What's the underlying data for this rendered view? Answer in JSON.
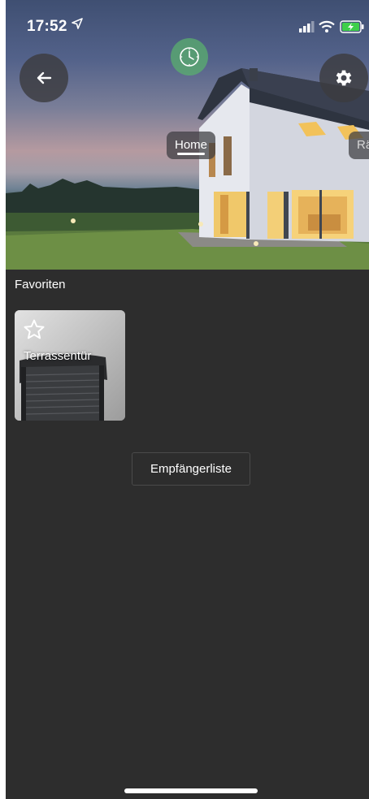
{
  "status_bar": {
    "time": "17:52",
    "location_icon": "location-arrow-icon",
    "signal_icon": "cellular-signal-icon",
    "wifi_icon": "wifi-icon",
    "battery_icon": "battery-charging-icon",
    "battery_color": "#3ecf4a"
  },
  "header": {
    "back_icon": "arrow-left-icon",
    "settings_icon": "gear-icon",
    "timer_icon": "clock-icon",
    "timer_color": "#5aaf6e"
  },
  "tabs": [
    {
      "label": "Home",
      "active": true
    },
    {
      "label": "Räume",
      "active": false
    }
  ],
  "favorites": {
    "title": "Favoriten",
    "items": [
      {
        "label": "Terrassentür",
        "icon": "star-outline-icon"
      }
    ]
  },
  "receiver_list_button": "Empfängerliste",
  "colors": {
    "background": "#2d2d2d",
    "text": "#ffffff"
  }
}
